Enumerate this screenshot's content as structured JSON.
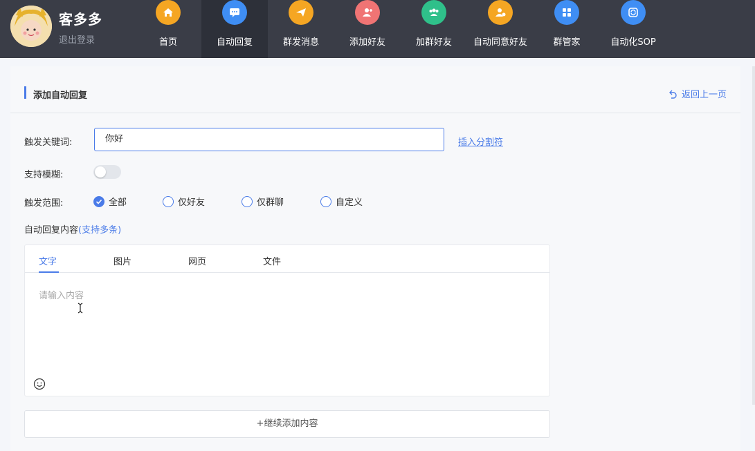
{
  "header": {
    "brand_name": "客多多",
    "logout_label": "退出登录",
    "nav": [
      {
        "label": "首页",
        "icon": "home-icon",
        "color": "#f5a623",
        "active": false
      },
      {
        "label": "自动回复",
        "icon": "chat-bubble-icon",
        "color": "#3f8ef4",
        "active": true
      },
      {
        "label": "群发消息",
        "icon": "paper-plane-icon",
        "color": "#f5a623",
        "active": false
      },
      {
        "label": "添加好友",
        "icon": "add-user-icon",
        "color": "#f07474",
        "active": false
      },
      {
        "label": "加群好友",
        "icon": "group-icon",
        "color": "#2fc08a",
        "active": false
      },
      {
        "label": "自动同意好友",
        "icon": "user-check-icon",
        "color": "#f5a623",
        "active": false
      },
      {
        "label": "群管家",
        "icon": "grid-apps-icon",
        "color": "#3f8ef4",
        "active": false
      },
      {
        "label": "自动化SOP",
        "icon": "refresh-cycle-icon",
        "color": "#3f8ef4",
        "active": false
      }
    ]
  },
  "panel": {
    "title": "添加自动回复",
    "back_label": "返回上一页"
  },
  "form": {
    "keyword_label": "触发关键词:",
    "keyword_value": "你好",
    "insert_separator": "插入分割符",
    "fuzzy_label": "支持模糊:",
    "fuzzy_enabled": false,
    "scope_label": "触发范围:",
    "scope_options": [
      {
        "label": "全部",
        "checked": true
      },
      {
        "label": "仅好友",
        "checked": false
      },
      {
        "label": "仅群聊",
        "checked": false
      },
      {
        "label": "自定义",
        "checked": false
      }
    ],
    "content_label": "自动回复内容",
    "content_hint": "(支持多条)"
  },
  "editor": {
    "tabs": [
      "文字",
      "图片",
      "网页",
      "文件"
    ],
    "active_tab": "文字",
    "placeholder": "请输入内容"
  },
  "add_more_label": "+继续添加内容",
  "colors": {
    "accent": "#4a7be8",
    "header_bg": "#3a3d47"
  }
}
